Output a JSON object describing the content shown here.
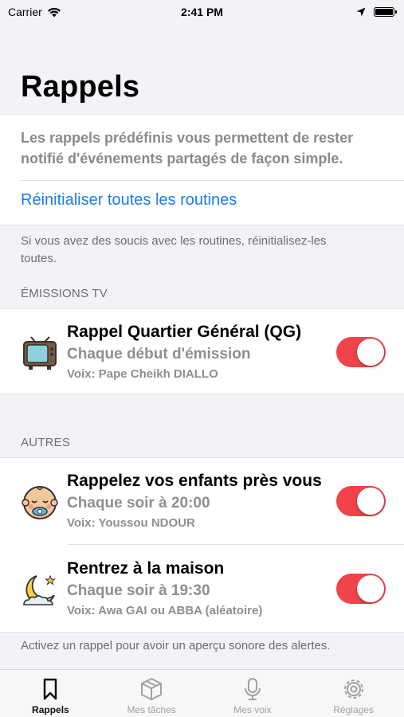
{
  "status_bar": {
    "carrier": "Carrier",
    "time": "2:41 PM",
    "battery_level": 1.0
  },
  "page": {
    "title": "Rappels",
    "intro": "Les rappels prédéfinis vous permettent de rester notifié d'événements partagés de façon simple.",
    "reset_link": "Réinitialiser toutes les routines",
    "reset_note": "Si vous avez des soucis avec les routines, réinitialisez-les toutes."
  },
  "sections": [
    {
      "header": "ÉMISSIONS TV",
      "rows": [
        {
          "icon": "tv-icon",
          "title": "Rappel Quartier Général (QG)",
          "subtitle": "Chaque début d'émission",
          "voice": "Voix: Pape Cheikh DIALLO",
          "enabled": true
        }
      ]
    },
    {
      "header": "AUTRES",
      "rows": [
        {
          "icon": "baby-icon",
          "title": "Rappelez vos enfants près vous",
          "subtitle": "Chaque soir à 20:00",
          "voice": "Voix: Youssou NDOUR",
          "enabled": true
        },
        {
          "icon": "moon-icon",
          "title": "Rentrez à la maison",
          "subtitle": "Chaque soir à 19:30",
          "voice": "Voix: Awa GAI ou ABBA (aléatoire)",
          "enabled": true
        }
      ]
    }
  ],
  "footer_note": "Activez un rappel pour avoir un aperçu sonore des alertes.",
  "tab_bar": {
    "tabs": [
      {
        "label": "Rappels",
        "icon": "bookmark-icon",
        "active": true
      },
      {
        "label": "Mes tâches",
        "icon": "box-icon",
        "active": false
      },
      {
        "label": "Mes voix",
        "icon": "microphone-icon",
        "active": false
      },
      {
        "label": "Réglages",
        "icon": "gear-icon",
        "active": false
      }
    ]
  },
  "colors": {
    "accent": "#1a7cf0",
    "toggle_on": "#f0434a",
    "background": "#f2f2f7"
  }
}
